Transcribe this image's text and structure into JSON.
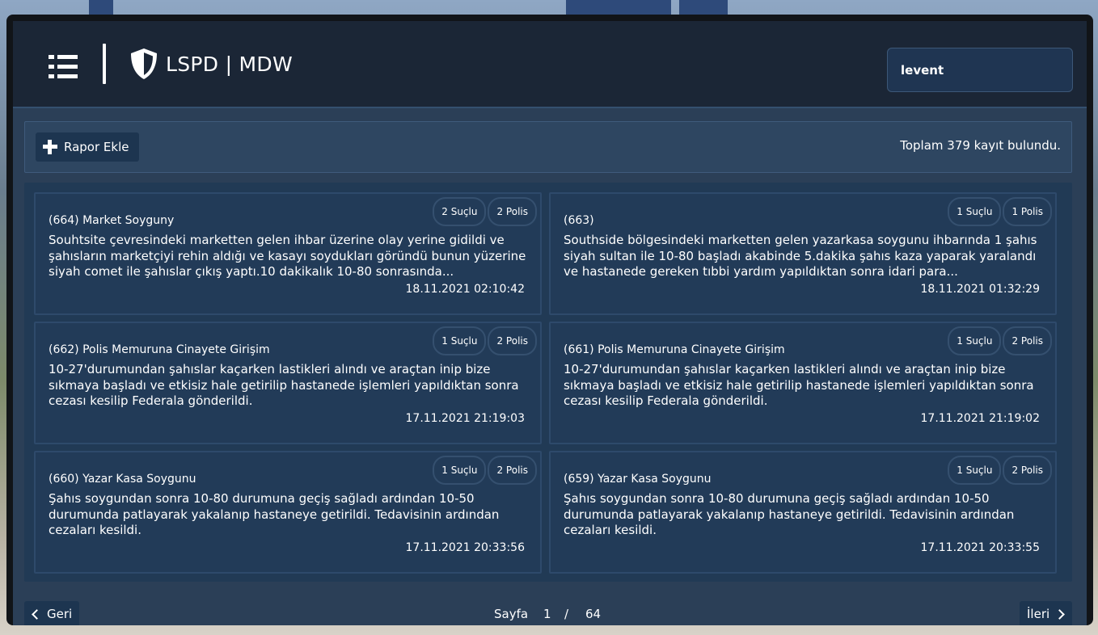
{
  "header": {
    "title": "LSPD | MDW",
    "search_value": "levent"
  },
  "toolbar": {
    "add_report_label": "Rapor Ekle",
    "total_text": "Toplam 379 kayıt bulundu."
  },
  "reports": [
    {
      "title": "(664) Market Soyguny",
      "suspects": "2 Suçlu",
      "police": "2 Polis",
      "description": "Souhtsite çevresindeki marketten gelen ihbar üzerine olay yerine gidildi ve şahısların marketçiyi rehin aldığı ve kasayı soydukları göründü bunun yüzerine siyah comet ile şahıslar çıkış yaptı.10 dakikalık 10-80 sonrasında...",
      "date": "18.11.2021 02:10:42"
    },
    {
      "title": "(663)",
      "suspects": "1 Suçlu",
      "police": "1 Polis",
      "description": "Southside bölgesindeki marketten gelen yazarkasa soygunu ihbarında 1 şahıs siyah sultan ile 10-80 başladı akabinde 5.dakika şahıs kaza yaparak yaralandı ve hastanede gereken tıbbi yardım yapıldıktan sonra idari para...",
      "date": "18.11.2021 01:32:29"
    },
    {
      "title": "(662) Polis Memuruna Cinayete Girişim",
      "suspects": "1 Suçlu",
      "police": "2 Polis",
      "description": "10-27'durumundan şahıslar kaçarken lastikleri alındı ve araçtan inip bize sıkmaya başladı ve etkisiz hale getirilip hastanede işlemleri yapıldıktan sonra cezası kesilip Federala gönderildi.",
      "date": "17.11.2021 21:19:03"
    },
    {
      "title": "(661) Polis Memuruna Cinayete Girişim",
      "suspects": "1 Suçlu",
      "police": "2 Polis",
      "description": "10-27'durumundan şahıslar kaçarken lastikleri alındı ve araçtan inip bize sıkmaya başladı ve etkisiz hale getirilip hastanede işlemleri yapıldıktan sonra cezası kesilip Federala gönderildi.",
      "date": "17.11.2021 21:19:02"
    },
    {
      "title": "(660) Yazar Kasa Soygunu",
      "suspects": "1 Suçlu",
      "police": "2 Polis",
      "description": "Şahıs soygundan sonra 10-80 durumuna geçiş sağladı ardından 10-50 durumunda patlayarak yakalanıp hastaneye getirildi. Tedavisinin ardından cezaları kesildi.",
      "date": "17.11.2021 20:33:56"
    },
    {
      "title": "(659) Yazar Kasa Soygunu",
      "suspects": "1 Suçlu",
      "police": "2 Polis",
      "description": "Şahıs soygundan sonra 10-80 durumuna geçiş sağladı ardından 10-50 durumunda patlayarak yakalanıp hastaneye getirildi. Tedavisinin ardından cezaları kesildi.",
      "date": "17.11.2021 20:33:55"
    }
  ],
  "pagination": {
    "prev_label": "Geri",
    "next_label": "İleri",
    "page_label": "Sayfa",
    "current_page": "1",
    "separator": "/",
    "total_pages": "64"
  },
  "colors": {
    "header_bg": "#1b2636",
    "content_bg": "#2b3f57",
    "card_bg": "#223b58",
    "button_bg": "#1d3550"
  }
}
